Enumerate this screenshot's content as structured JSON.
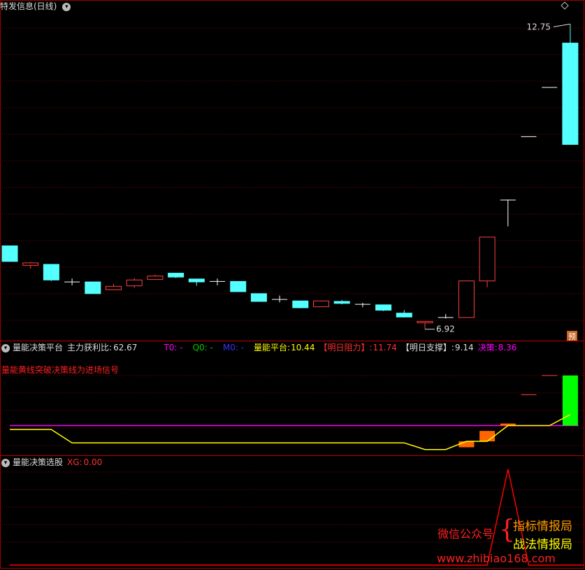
{
  "panels": {
    "main": {
      "title": "特发信息(日线)",
      "high_label": "12.75",
      "low_label": "6.92",
      "yu_badge": "预"
    },
    "indicator": {
      "title": "量能决策平台",
      "profit_label": "主力获利比:",
      "profit_value": "62.67",
      "t0": "T0: -",
      "q0": "Q0: -",
      "m0": "M0: -",
      "platform_label": "量能平台:",
      "platform_value": "10.44",
      "resist_label": "【明日阻力】:",
      "resist_value": "11.74",
      "support_label": "【明日支撑】:",
      "support_value": "9.14",
      "decision_label": "决策:",
      "decision_value": "8.36",
      "note": "量能黄线突破决策线为进场信号"
    },
    "selector": {
      "title": "量能决策选股",
      "xg_label": "XG:",
      "xg_value": "0.00"
    }
  },
  "watermark": {
    "prefix": "微信公众号",
    "brace": "{",
    "line1": "指标情报局",
    "line2": "战法情报局",
    "url": "www.zhibiao168.com"
  },
  "colors": {
    "up": "#ff4040",
    "down": "#54ffff",
    "grid": "#7a0000",
    "yellow": "#ffff00",
    "magenta": "#ff00ff",
    "green": "#00ff00",
    "orange": "#ff6600"
  },
  "chart_data": [
    {
      "type": "candlestick",
      "title": "特发信息(日线)",
      "ylim": [
        6.5,
        13.1
      ],
      "series": [
        {
          "o": 8.2,
          "h": 8.2,
          "l": 7.88,
          "c": 7.88
        },
        {
          "o": 7.8,
          "h": 7.87,
          "l": 7.73,
          "c": 7.85
        },
        {
          "o": 7.82,
          "h": 7.82,
          "l": 7.48,
          "c": 7.5
        },
        {
          "o": 7.46,
          "h": 7.53,
          "l": 7.39,
          "c": 7.46
        },
        {
          "o": 7.46,
          "h": 7.46,
          "l": 7.21,
          "c": 7.22
        },
        {
          "o": 7.3,
          "h": 7.42,
          "l": 7.3,
          "c": 7.37
        },
        {
          "o": 7.38,
          "h": 7.54,
          "l": 7.34,
          "c": 7.5
        },
        {
          "o": 7.51,
          "h": 7.61,
          "l": 7.51,
          "c": 7.58
        },
        {
          "o": 7.64,
          "h": 7.64,
          "l": 7.54,
          "c": 7.56
        },
        {
          "o": 7.52,
          "h": 7.52,
          "l": 7.38,
          "c": 7.46
        },
        {
          "o": 7.47,
          "h": 7.53,
          "l": 7.39,
          "c": 7.47
        },
        {
          "o": 7.47,
          "h": 7.47,
          "l": 7.26,
          "c": 7.26
        },
        {
          "o": 7.22,
          "h": 7.22,
          "l": 7.06,
          "c": 7.06
        },
        {
          "o": 7.1,
          "h": 7.18,
          "l": 7.04,
          "c": 7.1
        },
        {
          "o": 7.07,
          "h": 7.07,
          "l": 6.92,
          "c": 6.93
        },
        {
          "o": 6.95,
          "h": 7.08,
          "l": 6.95,
          "c": 7.07
        },
        {
          "o": 7.06,
          "h": 7.09,
          "l": 7.0,
          "c": 7.02
        },
        {
          "o": 6.98,
          "h": 7.03,
          "l": 6.94,
          "c": 7.0
        },
        {
          "o": 6.99,
          "h": 6.99,
          "l": 6.86,
          "c": 6.88
        },
        {
          "o": 6.82,
          "h": 6.88,
          "l": 6.73,
          "c": 6.74
        },
        {
          "o": 6.62,
          "h": 6.65,
          "l": 6.49,
          "c": 6.65
        },
        {
          "o": 6.72,
          "h": 6.8,
          "l": 6.71,
          "c": 6.73
        },
        {
          "o": 6.73,
          "h": 7.48,
          "l": 6.73,
          "c": 7.48
        },
        {
          "o": 7.48,
          "h": 8.38,
          "l": 7.35,
          "c": 8.38
        },
        {
          "o": 9.13,
          "h": 9.15,
          "l": 8.6,
          "c": 9.14
        },
        {
          "o": 10.44,
          "h": 10.44,
          "l": 10.44,
          "c": 10.44
        },
        {
          "o": 11.45,
          "h": 11.45,
          "l": 11.45,
          "c": 11.45
        },
        {
          "o": 12.36,
          "h": 12.75,
          "l": 10.28,
          "c": 10.28
        }
      ]
    },
    {
      "type": "line",
      "title": "量能决策平台",
      "ylim": [
        6.5,
        13.1
      ],
      "series": [
        {
          "name": "量能平台",
          "color": "#ffff00",
          "values": [
            null,
            8.1,
            8.1,
            7.2,
            7.2,
            7.2,
            7.2,
            7.2,
            7.2,
            7.2,
            7.2,
            7.2,
            7.2,
            7.2,
            7.2,
            7.2,
            7.2,
            7.2,
            7.2,
            7.2,
            6.75,
            6.75,
            7.3,
            7.3,
            8.36,
            8.36,
            8.36,
            9.1
          ]
        },
        {
          "name": "决策",
          "color": "#ff00ff",
          "constant": 8.36
        },
        {
          "name": "【明日阻力】",
          "values_at_end": [
            11.74,
            10.44
          ]
        },
        {
          "name": "【明日支撑】",
          "value": 9.14
        }
      ],
      "bars": [
        {
          "index": 22,
          "from": 6.9,
          "to": 7.3,
          "color": "#ff6600"
        },
        {
          "index": 23,
          "from": 7.3,
          "to": 8.0,
          "color": "#ff6600"
        },
        {
          "index": 24,
          "from": 8.36,
          "to": 8.5,
          "color": "#ff6600"
        },
        {
          "index": 27,
          "from": 8.36,
          "to": 11.74,
          "color": "#00ff00"
        }
      ]
    },
    {
      "type": "line",
      "title": "量能决策选股",
      "series": [
        {
          "name": "XG",
          "color": "#ff0000",
          "values": [
            0,
            0,
            0,
            0,
            0,
            0,
            0,
            0,
            0,
            0,
            0,
            0,
            0,
            0,
            0,
            0,
            0,
            0,
            0,
            0,
            0,
            0,
            0,
            0,
            1,
            0,
            0,
            0
          ]
        }
      ]
    }
  ]
}
